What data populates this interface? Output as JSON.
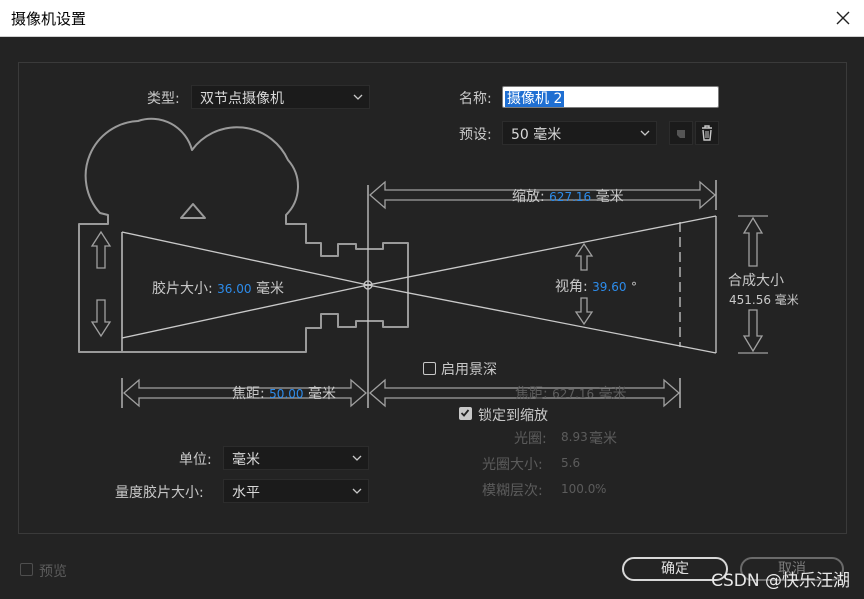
{
  "window": {
    "title": "摄像机设置"
  },
  "type_field": {
    "label": "类型:",
    "value": "双节点摄像机"
  },
  "name_field": {
    "label": "名称:",
    "value": "摄像机 2"
  },
  "preset_field": {
    "label": "预设:",
    "value": "50 毫米"
  },
  "diagram": {
    "zoom_label": "缩放:",
    "zoom_value": "627.16",
    "zoom_unit": "毫米",
    "film_size_label": "胶片大小:",
    "film_size_value": "36.00",
    "film_size_unit": "毫米",
    "view_angle_label": "视角:",
    "view_angle_value": "39.60",
    "view_angle_unit": "°",
    "comp_size_label": "合成大小",
    "comp_size_value": "451.56 毫米",
    "focal_label": "焦距:",
    "focal_value": "50.00",
    "focal_unit": "毫米",
    "focus_distance_label": "焦距:",
    "focus_distance_value": "627.16",
    "focus_distance_unit": "毫米"
  },
  "depth_of_field": {
    "label": "启用景深",
    "checked": false
  },
  "lock_to_zoom": {
    "label": "锁定到缩放",
    "checked": true
  },
  "aperture": {
    "label": "光圈:",
    "value": "8.93",
    "unit": "毫米"
  },
  "f_stop": {
    "label": "光圈大小:",
    "value": "5.6"
  },
  "blur_level": {
    "label": "模糊层次:",
    "value": "100.0",
    "unit": "%"
  },
  "units_field": {
    "label": "单位:",
    "value": "毫米"
  },
  "film_measure_field": {
    "label": "量度胶片大小:",
    "value": "水平"
  },
  "preview": {
    "label": "预览",
    "checked": false
  },
  "buttons": {
    "ok": "确定",
    "cancel": "取消"
  },
  "watermark": "CSDN @快乐汪湖"
}
